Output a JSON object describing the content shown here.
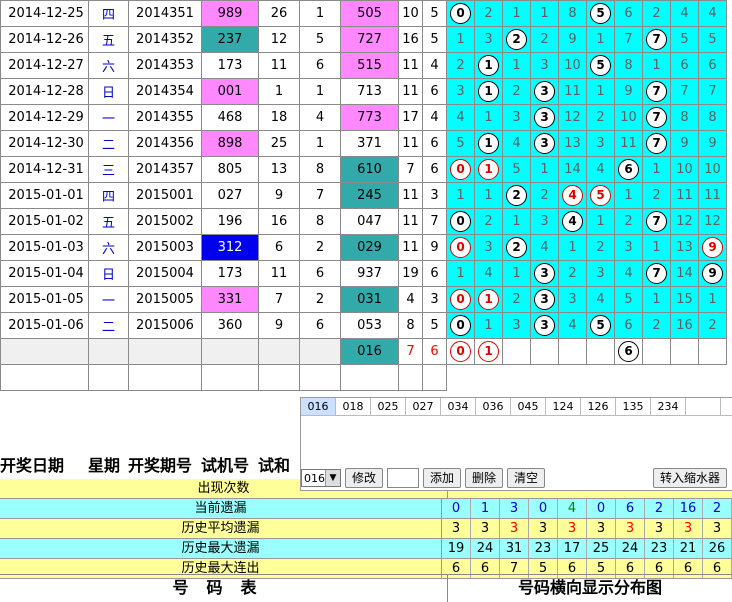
{
  "rows": [
    {
      "date": "2014-12-25",
      "wk": "四",
      "issue": "2014351",
      "trial": "989",
      "tcls": "pink",
      "c1": "26",
      "c2": "1",
      "draw": "505",
      "dcls": "pink",
      "s1": "10",
      "s2": "5",
      "dist": [
        "b:0",
        "2",
        "1",
        "1",
        "8",
        "b:5",
        "6",
        "2",
        "4",
        "4"
      ]
    },
    {
      "date": "2014-12-26",
      "wk": "五",
      "issue": "2014352",
      "trial": "237",
      "tcls": "teal",
      "c1": "12",
      "c2": "5",
      "draw": "727",
      "dcls": "pink",
      "s1": "16",
      "s2": "5",
      "dist": [
        "1",
        "3",
        "b:2",
        "2",
        "9",
        "1",
        "7",
        "b:7",
        "5",
        "5"
      ]
    },
    {
      "date": "2014-12-27",
      "wk": "六",
      "issue": "2014353",
      "trial": "173",
      "tcls": "",
      "c1": "11",
      "c2": "6",
      "draw": "515",
      "dcls": "pink",
      "s1": "11",
      "s2": "4",
      "dist": [
        "2",
        "b:1",
        "1",
        "3",
        "10",
        "b:5",
        "8",
        "1",
        "6",
        "6"
      ]
    },
    {
      "date": "2014-12-28",
      "wk": "日",
      "issue": "2014354",
      "trial": "001",
      "tcls": "pink",
      "c1": "1",
      "c2": "1",
      "draw": "713",
      "dcls": "",
      "s1": "11",
      "s2": "6",
      "dist": [
        "3",
        "b:1",
        "2",
        "b:3",
        "11",
        "1",
        "9",
        "b:7",
        "7",
        "7"
      ]
    },
    {
      "date": "2014-12-29",
      "wk": "一",
      "issue": "2014355",
      "trial": "468",
      "tcls": "",
      "c1": "18",
      "c2": "4",
      "draw": "773",
      "dcls": "pink",
      "s1": "17",
      "s2": "4",
      "dist": [
        "4",
        "1",
        "3",
        "b:3",
        "12",
        "2",
        "10",
        "b:7",
        "8",
        "8"
      ]
    },
    {
      "date": "2014-12-30",
      "wk": "二",
      "issue": "2014356",
      "trial": "898",
      "tcls": "pink",
      "c1": "25",
      "c2": "1",
      "draw": "371",
      "dcls": "",
      "s1": "11",
      "s2": "6",
      "dist": [
        "5",
        "b:1",
        "4",
        "b:3",
        "13",
        "3",
        "11",
        "b:7",
        "9",
        "9"
      ]
    },
    {
      "date": "2014-12-31",
      "wk": "三",
      "issue": "2014357",
      "trial": "805",
      "tcls": "",
      "c1": "13",
      "c2": "8",
      "draw": "610",
      "dcls": "teal",
      "s1": "7",
      "s2": "6",
      "dist": [
        "r:0",
        "r:1",
        "5",
        "1",
        "14",
        "4",
        "b:6",
        "1",
        "10",
        "10"
      ]
    },
    {
      "date": "2015-01-01",
      "wk": "四",
      "issue": "2015001",
      "trial": "027",
      "tcls": "",
      "c1": "9",
      "c2": "7",
      "draw": "245",
      "dcls": "teal",
      "s1": "11",
      "s2": "3",
      "dist": [
        "1",
        "1",
        "b:2",
        "2",
        "r:4",
        "r:5",
        "1",
        "2",
        "11",
        "11"
      ]
    },
    {
      "date": "2015-01-02",
      "wk": "五",
      "issue": "2015002",
      "trial": "196",
      "tcls": "",
      "c1": "16",
      "c2": "8",
      "draw": "047",
      "dcls": "",
      "s1": "11",
      "s2": "7",
      "dist": [
        "b:0",
        "2",
        "1",
        "3",
        "b:4",
        "1",
        "2",
        "b:7",
        "12",
        "12"
      ]
    },
    {
      "date": "2015-01-03",
      "wk": "六",
      "issue": "2015003",
      "trial": "312",
      "tcls": "blue",
      "c1": "6",
      "c2": "2",
      "draw": "029",
      "dcls": "teal",
      "s1": "11",
      "s2": "9",
      "dist": [
        "r:0",
        "3",
        "b:2",
        "4",
        "1",
        "2",
        "3",
        "1",
        "13",
        "r:9"
      ]
    },
    {
      "date": "2015-01-04",
      "wk": "日",
      "issue": "2015004",
      "trial": "173",
      "tcls": "",
      "c1": "11",
      "c2": "6",
      "draw": "937",
      "dcls": "",
      "s1": "19",
      "s2": "6",
      "dist": [
        "1",
        "4",
        "1",
        "b:3",
        "2",
        "3",
        "4",
        "b:7",
        "14",
        "b:9"
      ]
    },
    {
      "date": "2015-01-05",
      "wk": "一",
      "issue": "2015005",
      "trial": "331",
      "tcls": "pink",
      "c1": "7",
      "c2": "2",
      "draw": "031",
      "dcls": "teal",
      "s1": "4",
      "s2": "3",
      "dist": [
        "r:0",
        "r:1",
        "2",
        "b:3",
        "3",
        "4",
        "5",
        "1",
        "15",
        "1"
      ]
    },
    {
      "date": "2015-01-06",
      "wk": "二",
      "issue": "2015006",
      "trial": "360",
      "tcls": "",
      "c1": "9",
      "c2": "6",
      "draw": "053",
      "dcls": "",
      "s1": "8",
      "s2": "5",
      "dist": [
        "b:0",
        "1",
        "3",
        "b:3",
        "4",
        "b:5",
        "6",
        "2",
        "16",
        "2"
      ]
    }
  ],
  "pred": {
    "draw": "016",
    "s1": "7",
    "s2": "6",
    "dist": [
      "r:0",
      "r:1",
      "",
      "",
      "",
      "",
      "b:6",
      "",
      "",
      ""
    ]
  },
  "panel": {
    "codes": [
      "016",
      "018",
      "025",
      "027",
      "034",
      "036",
      "045",
      "124",
      "126",
      "135",
      "234",
      ""
    ],
    "select_value": "016",
    "btn_edit": "修改",
    "btn_add": "添加",
    "btn_del": "删除",
    "btn_clear": "清空",
    "btn_filter": "转入缩水器"
  },
  "header": {
    "date": "开奖日期",
    "wk": "星期",
    "issue": "开奖期号",
    "trial": "试机号",
    "sum": "试和"
  },
  "stats": [
    {
      "label": "出现次数",
      "vals": [],
      "cls": "yel"
    },
    {
      "label": "当前遗漏",
      "vals": [
        "0",
        "1",
        "3",
        "0",
        "4",
        "0",
        "6",
        "2",
        "16",
        "2"
      ],
      "cls": "cyn",
      "colors": [
        "b",
        "b",
        "b",
        "b",
        "g",
        "b",
        "b",
        "b",
        "b",
        "b"
      ]
    },
    {
      "label": "历史平均遗漏",
      "vals": [
        "3",
        "3",
        "3",
        "3",
        "3",
        "3",
        "3",
        "3",
        "3",
        "3"
      ],
      "cls": "yel",
      "colors": [
        "k",
        "k",
        "r",
        "k",
        "r",
        "k",
        "r",
        "k",
        "r",
        "k"
      ]
    },
    {
      "label": "历史最大遗漏",
      "vals": [
        "19",
        "24",
        "31",
        "23",
        "17",
        "25",
        "24",
        "23",
        "21",
        "26"
      ],
      "cls": "cyn",
      "colors": [
        "k",
        "k",
        "k",
        "k",
        "k",
        "k",
        "k",
        "k",
        "k",
        "k"
      ]
    },
    {
      "label": "历史最大连出",
      "vals": [
        "6",
        "6",
        "7",
        "5",
        "6",
        "5",
        "6",
        "6",
        "6",
        "6"
      ],
      "cls": "yel",
      "colors": [
        "k",
        "k",
        "k",
        "k",
        "k",
        "k",
        "k",
        "k",
        "k",
        "k"
      ]
    }
  ],
  "footer": {
    "left": "号码表",
    "right": "号码横向显示分布图"
  },
  "colors": {
    "teal": "#33aaaa",
    "pink": "#ff88ff",
    "cyan": "#00ffff",
    "blue": "#0000ee"
  }
}
